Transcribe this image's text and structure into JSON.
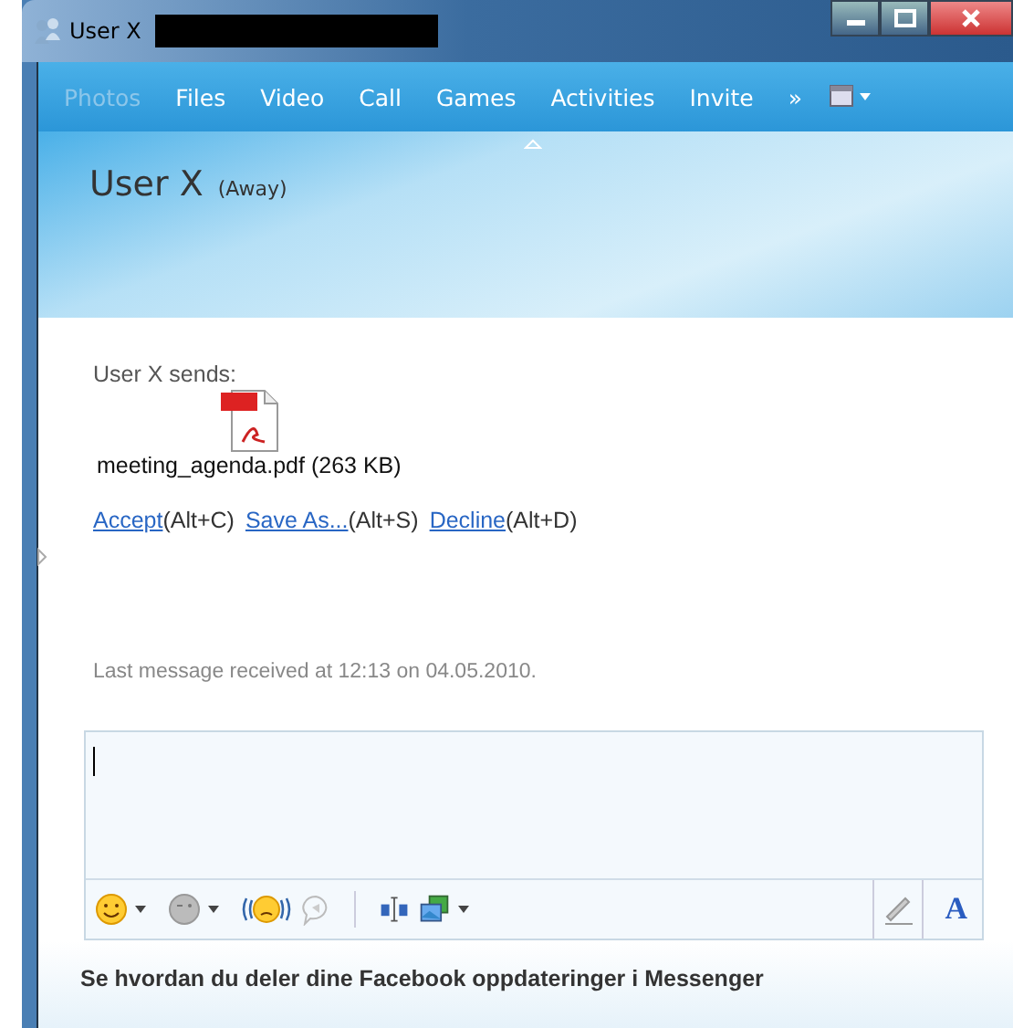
{
  "window": {
    "title": "User X"
  },
  "nav": [
    {
      "label": "Photos",
      "disabled": true
    },
    {
      "label": "Files",
      "disabled": false
    },
    {
      "label": "Video",
      "disabled": false
    },
    {
      "label": "Call",
      "disabled": false
    },
    {
      "label": "Games",
      "disabled": false
    },
    {
      "label": "Activities",
      "disabled": false
    },
    {
      "label": "Invite",
      "disabled": false
    }
  ],
  "nav_more": "»",
  "contact": {
    "name": "User X",
    "status": "(Away)"
  },
  "transfer": {
    "sender": "User X sends:",
    "file": "meeting_agenda.pdf (263 KB)",
    "actions": [
      {
        "link": "Accept",
        "shortcut": "(Alt+C)"
      },
      {
        "link": "Save As...",
        "shortcut": "(Alt+S)"
      },
      {
        "link": "Decline",
        "shortcut": "(Alt+D)"
      }
    ]
  },
  "last_message": "Last message received at 12:13 on 04.05.2010.",
  "font_button": "A",
  "footer": "Se hvordan du deler dine Facebook oppdateringer i Messenger"
}
